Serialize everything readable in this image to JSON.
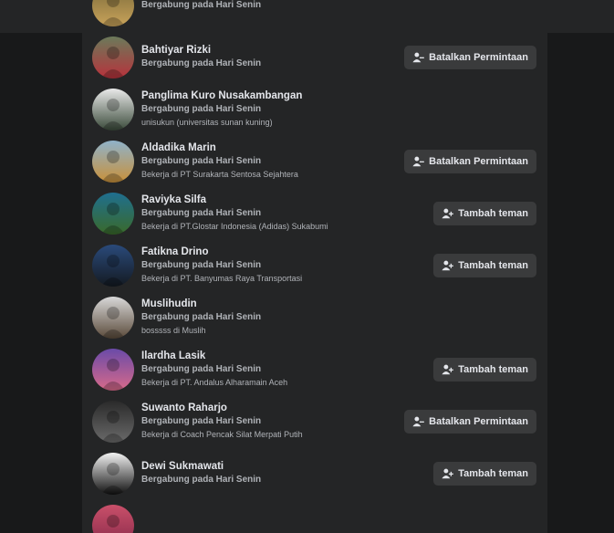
{
  "friends": [
    {
      "name": "",
      "joined": "Bergabung pada Hari Senin",
      "work": "",
      "action": "",
      "icon": "user-avatar-icon",
      "colors": [
        "#7a6a3a",
        "#c9a35a"
      ]
    },
    {
      "name": "Bahtiyar Rizki",
      "joined": "Bergabung pada Hari Senin",
      "work": "",
      "action": "Batalkan Permintaan",
      "icon": "user-minus-icon",
      "colors": [
        "#6b7a5a",
        "#b8323c"
      ]
    },
    {
      "name": "Panglima Kuro Nusakambangan",
      "joined": "Bergabung pada Hari Senin",
      "work": "unisukun (universitas sunan kuning)",
      "action": "",
      "icon": "",
      "colors": [
        "#e9e9e9",
        "#3a4a3a"
      ]
    },
    {
      "name": "Aldadika Marin",
      "joined": "Bergabung pada Hari Senin",
      "work": "Bekerja di PT Surakarta Sentosa Sejahtera",
      "action": "Batalkan Permintaan",
      "icon": "user-minus-icon",
      "colors": [
        "#8fb2c9",
        "#c9913a"
      ]
    },
    {
      "name": "Raviyka Silfa",
      "joined": "Bergabung pada Hari Senin",
      "work": "Bekerja di PT.Glostar Indonesia (Adidas) Sukabumi",
      "action": "Tambah teman",
      "icon": "user-plus-icon",
      "colors": [
        "#1f6f8f",
        "#3a6a2a"
      ]
    },
    {
      "name": "Fatikna Drino",
      "joined": "Bergabung pada Hari Senin",
      "work": "Bekerja di PT. Banyumas Raya Transportasi",
      "action": "Tambah teman",
      "icon": "user-plus-icon",
      "colors": [
        "#2a4a7a",
        "#141a22"
      ]
    },
    {
      "name": "Muslihudin",
      "joined": "Bergabung pada Hari Senin",
      "work": "bosssss di Muslih",
      "action": "",
      "icon": "",
      "colors": [
        "#d8d8d8",
        "#5a4a3a"
      ]
    },
    {
      "name": "Ilardha Lasik",
      "joined": "Bergabung pada Hari Senin",
      "work": "Bekerja di PT. Andalus Alharamain Aceh",
      "action": "Tambah teman",
      "icon": "user-plus-icon",
      "colors": [
        "#6a4aa8",
        "#d86a8a"
      ]
    },
    {
      "name": "Suwanto Raharjo",
      "joined": "Bergabung pada Hari Senin",
      "work": "Bekerja di Coach Pencak Silat Merpati Putih",
      "action": "Batalkan Permintaan",
      "icon": "user-minus-icon",
      "colors": [
        "#2a2a2a",
        "#6a6a6a"
      ]
    },
    {
      "name": "Dewi Sukmawati",
      "joined": "Bergabung pada Hari Senin",
      "work": "",
      "action": "Tambah teman",
      "icon": "user-plus-icon",
      "colors": [
        "#f2f2f2",
        "#111111"
      ]
    },
    {
      "name": "",
      "joined": "",
      "work": "",
      "action": "",
      "icon": "",
      "colors": [
        "#c9506a",
        "#8a2a4a"
      ]
    }
  ]
}
